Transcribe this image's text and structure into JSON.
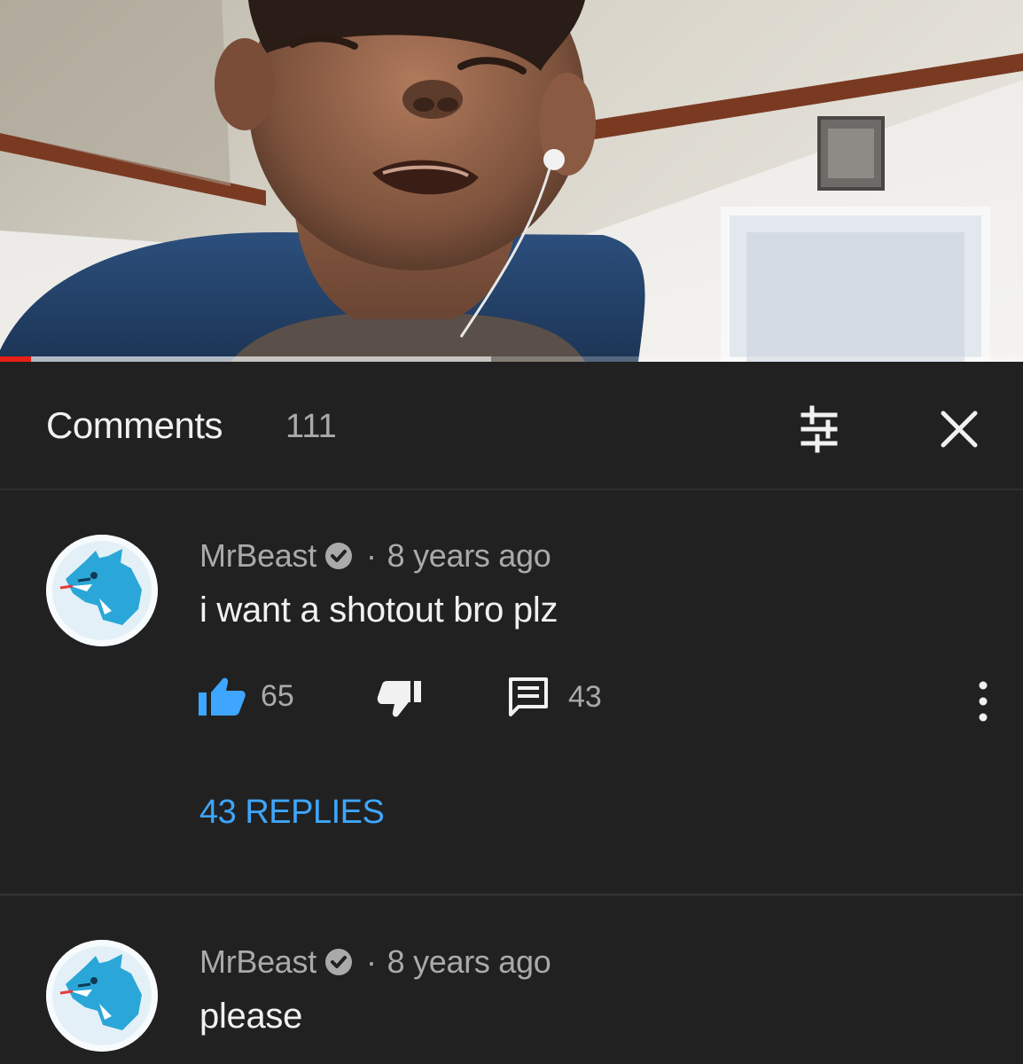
{
  "video": {
    "progress_fraction": 0.03,
    "buffer_fraction": 0.48
  },
  "comments_panel": {
    "title": "Comments",
    "count": "111",
    "icons": {
      "sort": "sort-filter-icon",
      "close": "close-icon"
    }
  },
  "comments": [
    {
      "author": "MrBeast",
      "separator": "·",
      "time": "8 years ago",
      "text": "i want a shotout bro plz",
      "likes": "65",
      "reply_count": "43",
      "replies_label": "43 REPLIES"
    },
    {
      "author": "MrBeast",
      "separator": "·",
      "time": "8 years ago",
      "text": "please"
    }
  ],
  "colors": {
    "panel_bg": "#212121",
    "accent_blue": "#3ea6ff",
    "like_blue": "#3ea6ff",
    "secondary_text": "#aaaaaa",
    "primary_text": "#f1f1f1",
    "progress_red": "#e62117"
  }
}
